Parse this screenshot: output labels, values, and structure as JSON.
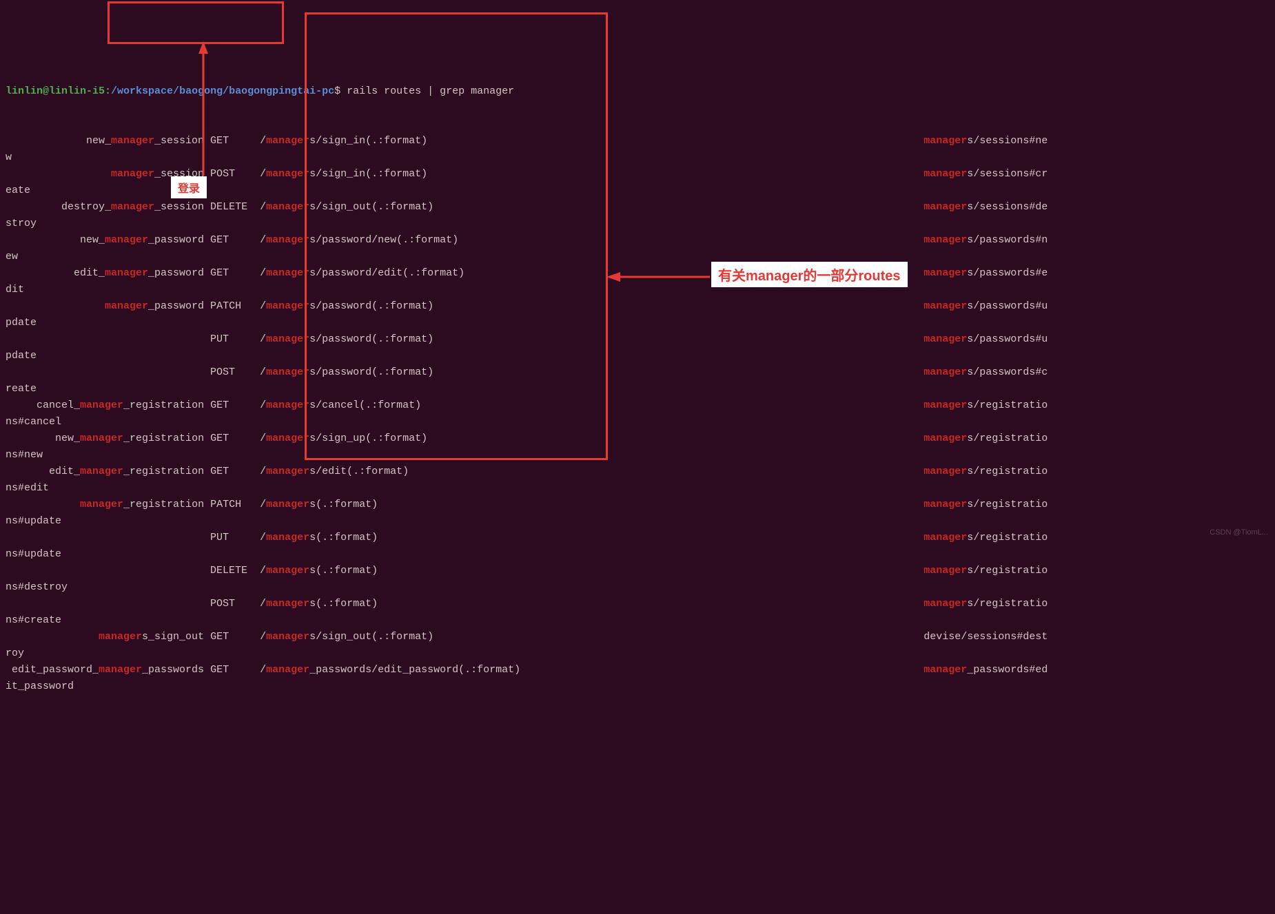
{
  "prompt": {
    "user": "linlin@linlin-i5",
    "sep": ":",
    "path": "/workspace/baogong/baogongpingtai-pc",
    "dollar": "$",
    "command": " rails routes | grep manager"
  },
  "routes": [
    {
      "prefix_pre": "            new_",
      "prefix_hl": "manager",
      "prefix_post": "_session",
      "verb": "GET   ",
      "path_pre": "/",
      "path_hl": "manager",
      "path_post": "s/sign_in(.:format)",
      "ctrl_hl": "manager",
      "ctrl_post": "s/sessions#ne",
      "wrap": "w"
    },
    {
      "prefix_pre": "                ",
      "prefix_hl": "manager",
      "prefix_post": "_session",
      "verb": "POST  ",
      "path_pre": "/",
      "path_hl": "manager",
      "path_post": "s/sign_in(.:format)",
      "ctrl_hl": "manager",
      "ctrl_post": "s/sessions#cr",
      "wrap": "eate"
    },
    {
      "prefix_pre": "        destroy_",
      "prefix_hl": "manager",
      "prefix_post": "_session",
      "verb": "DELETE",
      "path_pre": "/",
      "path_hl": "manager",
      "path_post": "s/sign_out(.:format)",
      "ctrl_hl": "manager",
      "ctrl_post": "s/sessions#de",
      "wrap": "stroy"
    },
    {
      "prefix_pre": "           new_",
      "prefix_hl": "manager",
      "prefix_post": "_password",
      "verb": "GET   ",
      "path_pre": "/",
      "path_hl": "manager",
      "path_post": "s/password/new(.:format)",
      "ctrl_hl": "manager",
      "ctrl_post": "s/passwords#n",
      "wrap": "ew"
    },
    {
      "prefix_pre": "          edit_",
      "prefix_hl": "manager",
      "prefix_post": "_password",
      "verb": "GET   ",
      "path_pre": "/",
      "path_hl": "manager",
      "path_post": "s/password/edit(.:format)",
      "ctrl_hl": "manager",
      "ctrl_post": "s/passwords#e",
      "wrap": "dit"
    },
    {
      "prefix_pre": "               ",
      "prefix_hl": "manager",
      "prefix_post": "_password",
      "verb": "PATCH ",
      "path_pre": "/",
      "path_hl": "manager",
      "path_post": "s/password(.:format)",
      "ctrl_hl": "manager",
      "ctrl_post": "s/passwords#u",
      "wrap": "pdate"
    },
    {
      "prefix_pre": "                                ",
      "prefix_hl": "",
      "prefix_post": "",
      "verb": "PUT   ",
      "path_pre": "/",
      "path_hl": "manager",
      "path_post": "s/password(.:format)",
      "ctrl_hl": "manager",
      "ctrl_post": "s/passwords#u",
      "wrap": "pdate"
    },
    {
      "prefix_pre": "                                ",
      "prefix_hl": "",
      "prefix_post": "",
      "verb": "POST  ",
      "path_pre": "/",
      "path_hl": "manager",
      "path_post": "s/password(.:format)",
      "ctrl_hl": "manager",
      "ctrl_post": "s/passwords#c",
      "wrap": "reate"
    },
    {
      "prefix_pre": "    cancel_",
      "prefix_hl": "manager",
      "prefix_post": "_registration",
      "verb": "GET   ",
      "path_pre": "/",
      "path_hl": "manager",
      "path_post": "s/cancel(.:format)",
      "ctrl_hl": "manager",
      "ctrl_post": "s/registratio",
      "wrap": "ns#cancel"
    },
    {
      "prefix_pre": "       new_",
      "prefix_hl": "manager",
      "prefix_post": "_registration",
      "verb": "GET   ",
      "path_pre": "/",
      "path_hl": "manager",
      "path_post": "s/sign_up(.:format)",
      "ctrl_hl": "manager",
      "ctrl_post": "s/registratio",
      "wrap": "ns#new"
    },
    {
      "prefix_pre": "      edit_",
      "prefix_hl": "manager",
      "prefix_post": "_registration",
      "verb": "GET   ",
      "path_pre": "/",
      "path_hl": "manager",
      "path_post": "s/edit(.:format)",
      "ctrl_hl": "manager",
      "ctrl_post": "s/registratio",
      "wrap": "ns#edit"
    },
    {
      "prefix_pre": "           ",
      "prefix_hl": "manager",
      "prefix_post": "_registration",
      "verb": "PATCH ",
      "path_pre": "/",
      "path_hl": "manager",
      "path_post": "s(.:format)",
      "ctrl_hl": "manager",
      "ctrl_post": "s/registratio",
      "wrap": "ns#update"
    },
    {
      "prefix_pre": "                                ",
      "prefix_hl": "",
      "prefix_post": "",
      "verb": "PUT   ",
      "path_pre": "/",
      "path_hl": "manager",
      "path_post": "s(.:format)",
      "ctrl_hl": "manager",
      "ctrl_post": "s/registratio",
      "wrap": "ns#update"
    },
    {
      "prefix_pre": "                                ",
      "prefix_hl": "",
      "prefix_post": "",
      "verb": "DELETE",
      "path_pre": "/",
      "path_hl": "manager",
      "path_post": "s(.:format)",
      "ctrl_hl": "manager",
      "ctrl_post": "s/registratio",
      "wrap": "ns#destroy"
    },
    {
      "prefix_pre": "                                ",
      "prefix_hl": "",
      "prefix_post": "",
      "verb": "POST  ",
      "path_pre": "/",
      "path_hl": "manager",
      "path_post": "s(.:format)",
      "ctrl_hl": "manager",
      "ctrl_post": "s/registratio",
      "wrap": "ns#create"
    },
    {
      "prefix_pre": "              ",
      "prefix_hl": "manager",
      "prefix_post": "s_sign_out",
      "verb": "GET   ",
      "path_pre": "/",
      "path_hl": "manager",
      "path_post": "s/sign_out(.:format)",
      "ctrl_hl": "",
      "ctrl_post": "devise/sessions#dest",
      "wrap": "roy"
    },
    {
      "prefix_pre": " edit_password_",
      "prefix_hl": "manager",
      "prefix_post": "_passwords",
      "verb": "GET   ",
      "path_pre": "/",
      "path_hl": "manager",
      "path_post": "_passwords/edit_password(.:format)",
      "ctrl_hl": "manager",
      "ctrl_post": "_passwords#ed",
      "wrap": "it_password"
    }
  ],
  "annotations": {
    "login_label": "登录",
    "routes_label": "有关manager的一部分routes"
  },
  "watermark": "CSDN @TiomL..."
}
